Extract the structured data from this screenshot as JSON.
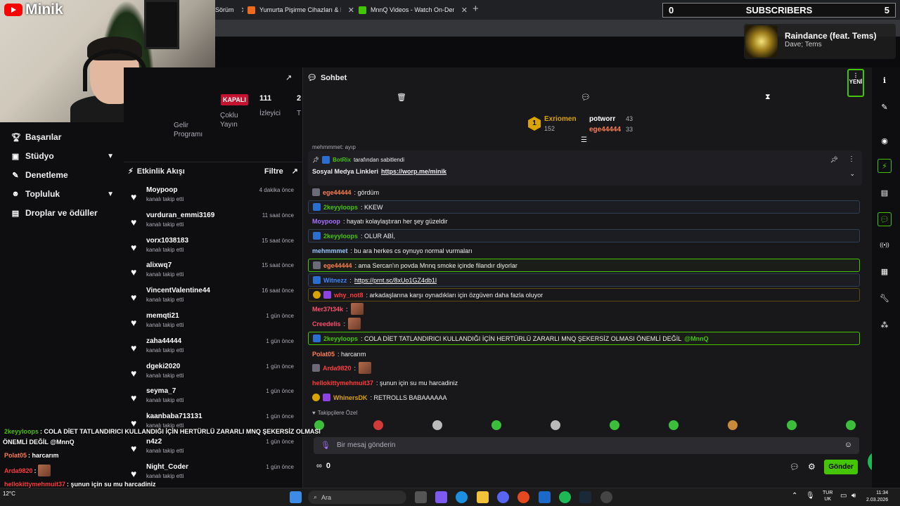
{
  "browser": {
    "tabs": [
      {
        "label": "Sörüm",
        "color": "#888"
      },
      {
        "label": "Yumurta Pişirme Cihazları & Hızlı",
        "color": "#f06a1d"
      },
      {
        "label": "MnnQ Videos - Watch On-Demand",
        "color": "#45c400"
      }
    ],
    "new_tab": "+"
  },
  "overlay": {
    "channel": "Minik",
    "subscribers_left": "0",
    "subscribers_label": "SUBSCRIBERS",
    "subscribers_right": "5",
    "now_playing_title": "Raindance (feat. Tems)",
    "now_playing_artist": "Dave; Tems",
    "chat_lines": [
      {
        "user": "2keyyloops",
        "text": ": COLA DİET TATLANDIRICI KULLANDIĞI İÇİN HERTÜRLÜ ZARARLI MNQ ŞEKERSİZ OLMASI"
      },
      {
        "user": "",
        "text": "ÖNEMLİ DEĞİL @MnnQ"
      },
      {
        "user": "Polat05",
        "text": ": harcarım"
      },
      {
        "user": "Arda9820",
        "text": ":"
      },
      {
        "user": "hellokittymehmuit37",
        "text": ": şunun için su mu harcadiniz"
      },
      {
        "user": "WhinersDK",
        "text": ": RETROLLS BABAAAAAA"
      }
    ]
  },
  "left_nav": {
    "items": [
      {
        "label": "Başarılar",
        "icon": "trophy-icon"
      },
      {
        "label": "Stüdyo",
        "icon": "studio-icon"
      },
      {
        "label": "Denetleme",
        "icon": "wrench-icon"
      },
      {
        "label": "Topluluk",
        "icon": "people-icon"
      },
      {
        "label": "Droplar ve ödüller",
        "icon": "gift-icon"
      }
    ]
  },
  "stream_info": {
    "status": "KAPALI",
    "viewers": "111",
    "viewers_label": "İzleyici",
    "multi_stream": "Çoklu Yayın",
    "income": "Gelir Programı",
    "extra_num": "2",
    "extra_label": "T"
  },
  "activity_feed": {
    "title": "Etkinlik Akışı",
    "filter": "Filtre",
    "items": [
      {
        "name": "Moypoop",
        "action": "kanalı takip etti",
        "time": "4 dakika önce"
      },
      {
        "name": "vurduran_emmi3169",
        "action": "kanalı takip etti",
        "time": "11 saat önce"
      },
      {
        "name": "vorx1038183",
        "action": "kanalı takip etti",
        "time": "15 saat önce"
      },
      {
        "name": "alixwq7",
        "action": "kanalı takip etti",
        "time": "15 saat önce"
      },
      {
        "name": "VincentValentine44",
        "action": "kanalı takip etti",
        "time": "16 saat önce"
      },
      {
        "name": "memqti21",
        "action": "kanalı takip etti",
        "time": "1 gün önce"
      },
      {
        "name": "zaha44444",
        "action": "kanalı takip etti",
        "time": "1 gün önce"
      },
      {
        "name": "dgeki2020",
        "action": "kanalı takip etti",
        "time": "1 gün önce"
      },
      {
        "name": "seyma_7",
        "action": "kanalı takip etti",
        "time": "1 gün önce"
      },
      {
        "name": "kaanbaba713131",
        "action": "kanalı takip etti",
        "time": "1 gün önce"
      },
      {
        "name": "n4z2",
        "action": "kanalı takip etti",
        "time": "1 gün önce"
      },
      {
        "name": "Night_Coder",
        "action": "kanalı takip etti",
        "time": "1 gün önce"
      }
    ]
  },
  "chat": {
    "title": "Sohbet",
    "new_badge": "YENİ",
    "leaderboard": [
      {
        "name": "Exriomen",
        "value": "152",
        "rank": "1"
      },
      {
        "name": "potworr",
        "value": "43"
      },
      {
        "name": "ege44444",
        "value": "33"
      }
    ],
    "scrolled_line": "mehmmmet: ayıp",
    "pinned": {
      "by": "BotRix",
      "by_suffix": "tarafından sabitlendi",
      "text": "Sosyal Medya Linkleri",
      "link": "https://worp.me/minik"
    },
    "messages": [
      {
        "user": "ege44444",
        "color": "#ff7f50",
        "text": ": gördüm",
        "style": "",
        "badge": "sub"
      },
      {
        "user": "2keyyloops",
        "color": "#45c400",
        "text": ": KKEW",
        "style": "hl",
        "badge": "bot"
      },
      {
        "user": "Moypoop",
        "color": "#a970ff",
        "text": ": hayatı kolaylaştıran her şey güzeldir",
        "style": "",
        "badge": ""
      },
      {
        "user": "2keyyloops",
        "color": "#45c400",
        "text": ": OLUR ABİ,",
        "style": "hl",
        "badge": "bot"
      },
      {
        "user": "mehmmmet",
        "color": "#9ac8ff",
        "text": ": bu ara herkes cs oynuyo normal vurmaları",
        "style": "",
        "badge": ""
      },
      {
        "user": "ege44444",
        "color": "#ff7f50",
        "text": ": ama Sercan'ın povda Mnnq smoke içinde filandır diyorlar",
        "style": "hl-green",
        "badge": "sub"
      },
      {
        "user": "Witnezz",
        "color": "#3d87ff",
        "text": ":",
        "link": "https://prnt.sc/8xUo1GZ4db1l",
        "style": "hl",
        "badge": "bot"
      },
      {
        "user": "why_not8",
        "color": "#ff3c3c",
        "text": ": arkadaşlarına karşı oynadıkları için özgüven daha fazla oluyor",
        "style": "hl-gold",
        "badge": "gold"
      },
      {
        "user": "Mer37t34k",
        "color": "#ff4f6b",
        "text": ":",
        "style": "",
        "badge": "",
        "emote": true
      },
      {
        "user": "Creedelis",
        "color": "#ff4f6b",
        "text": ":",
        "style": "",
        "badge": "",
        "emote": true
      },
      {
        "user": "2keyyloops",
        "color": "#45c400",
        "text": ": COLA DİET TATLANDIRICI KULLANDIĞI İÇİN HERTÜRLÜ ZARARLI MNQ ŞEKERSİZ OLMASI ÖNEMLİ DEĞİL",
        "mention": "@MnnQ",
        "style": "hl-green",
        "badge": "bot"
      },
      {
        "user": "Polat05",
        "color": "#ff7f50",
        "text": ": harcarım",
        "style": "",
        "badge": ""
      },
      {
        "user": "Arda9820",
        "color": "#ff3c3c",
        "text": ":",
        "style": "",
        "badge": "sub",
        "emote": true
      },
      {
        "user": "hellokittymehmuit37",
        "color": "#ff3c3c",
        "text": ": şunun için su mu harcadiniz",
        "style": "",
        "badge": ""
      },
      {
        "user": "WhinersDK",
        "color": "#d9a300",
        "text": ": RETROLLS BABAAAAAA",
        "style": "",
        "badge": "gold"
      }
    ],
    "followers_only": "Takipçilere Özel",
    "input_placeholder": "Bir mesaj gönderin",
    "points": "0",
    "send": "Gönder"
  },
  "taskbar": {
    "search": "Ara",
    "weather": "12°C",
    "lang_top": "TUR",
    "lang_bottom": "UK",
    "time": "11:34",
    "date": "2.03.2026"
  }
}
